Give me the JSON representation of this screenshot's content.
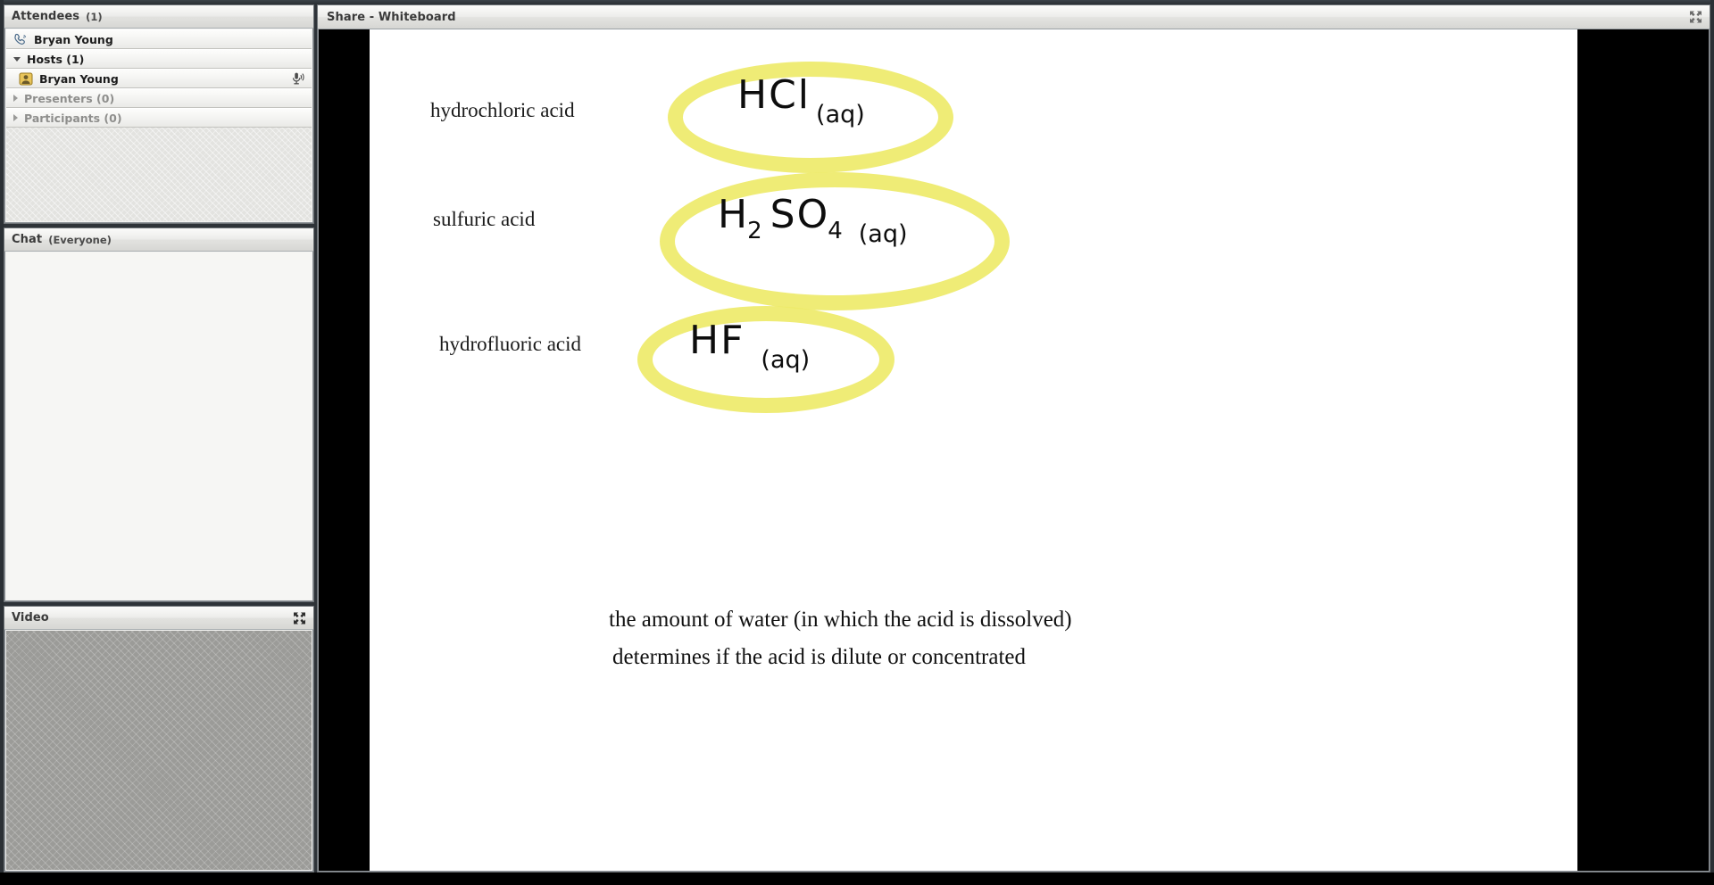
{
  "window": {
    "chrome_color": "#2b3035"
  },
  "attendees": {
    "title": "Attendees",
    "count_label": "(1)",
    "self_row": {
      "name": "Bryan Young",
      "icon": "phone-handset-icon"
    },
    "groups": [
      {
        "label": "Hosts (1)",
        "expanded": true,
        "icon": "chevron-down-icon",
        "members": [
          {
            "name": "Bryan Young",
            "avatar_icon": "host-avatar-icon",
            "status_icon": "microphone-active-icon"
          }
        ]
      },
      {
        "label": "Presenters (0)",
        "expanded": false,
        "icon": "chevron-right-icon",
        "members": []
      },
      {
        "label": "Participants (0)",
        "expanded": false,
        "icon": "chevron-right-icon",
        "members": []
      }
    ]
  },
  "chat": {
    "title": "Chat",
    "scope_label": "(Everyone)",
    "messages": []
  },
  "video": {
    "title": "Video",
    "expand_icon": "fullscreen-icon"
  },
  "share": {
    "title": "Share - Whiteboard",
    "expand_icon": "fullscreen-icon"
  },
  "whiteboard": {
    "rows": [
      {
        "label": "hydrochloric acid",
        "formula_main": "HCl",
        "formula_sub": "",
        "formula_state": "(aq)",
        "highlight_color": "#eeea6a"
      },
      {
        "label": "sulfuric acid",
        "formula_main": "H",
        "formula_sub": "2",
        "formula_tail": "SO",
        "formula_sub2": "4",
        "formula_state": "(aq)",
        "highlight_color": "#eeea6a"
      },
      {
        "label": "hydrofluoric acid",
        "formula_main": "HF",
        "formula_sub": "",
        "formula_state": "(aq)",
        "highlight_color": "#eeea6a"
      }
    ],
    "note_line_1": "the amount of water (in which the acid is dissolved)",
    "note_line_2": "determines if the acid is dilute or concentrated"
  }
}
